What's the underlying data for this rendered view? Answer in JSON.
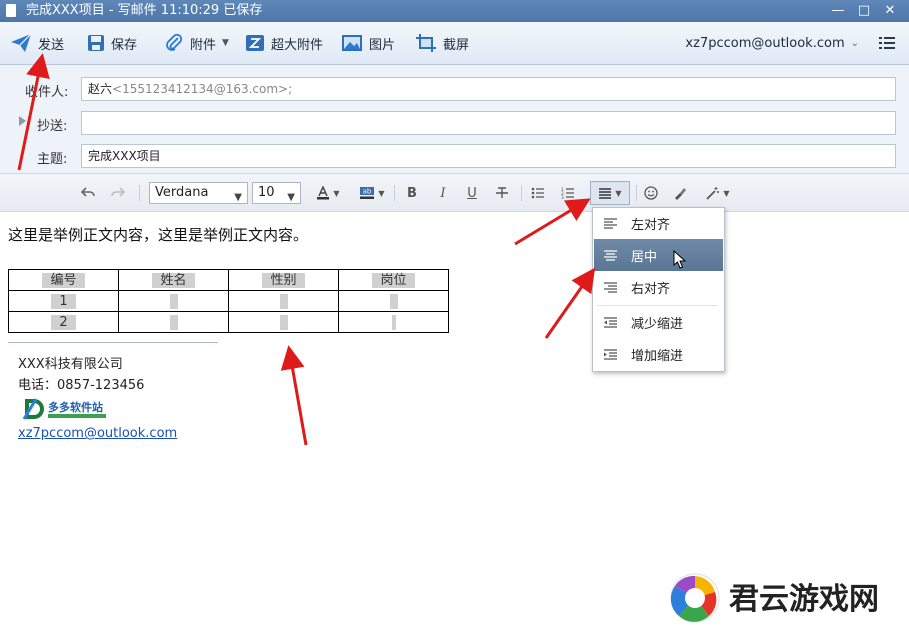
{
  "window": {
    "title": "完成XXX项目 - 写邮件   11:10:29 已保存",
    "controls": [
      "—",
      "□",
      "✕"
    ]
  },
  "toolbar": {
    "send": "发送",
    "save": "保存",
    "attach": "附件",
    "big_attach": "超大附件",
    "image": "图片",
    "screenshot": "截屏",
    "account": "xz7pccom@outlook.com"
  },
  "header": {
    "to_label": "收件人:",
    "to_name": "赵六",
    "to_email": "<155123412134@163.com>;",
    "cc_label": "抄送:",
    "cc_value": "",
    "subject_label": "主题:",
    "subject_value": "完成XXX项目"
  },
  "format": {
    "font": "Verdana",
    "size": "10",
    "bold": "B",
    "italic": "I",
    "underline": "U"
  },
  "body": {
    "text": "这里是举例正文内容，这里是举例正文内容。",
    "table_header": [
      "编号",
      "姓名",
      "性别",
      "岗位"
    ],
    "table_rows": [
      [
        "1",
        "",
        "",
        ""
      ],
      [
        "2",
        "",
        "",
        ""
      ]
    ]
  },
  "signature": {
    "company": "XXX科技有限公司",
    "phone": "电话：0857-123456",
    "email": "xz7pccom@outlook.com",
    "logo_text": "多多软件站"
  },
  "align_menu": {
    "items": [
      "左对齐",
      "居中",
      "右对齐",
      "减少缩进",
      "增加缩进"
    ],
    "active_index": 1
  },
  "watermark": {
    "text": "君云游戏网"
  },
  "colors": {
    "titlebar": "#5f87b8",
    "accent": "#1f66c5",
    "arrow": "#e0191a",
    "menu_active": "#6480a0"
  }
}
